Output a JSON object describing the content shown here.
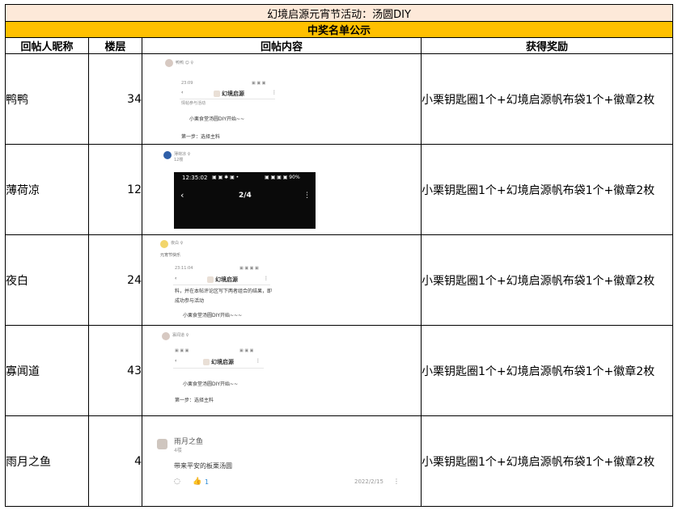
{
  "title": "幻境启源元宵节活动：汤圆DIY",
  "subtitle": "中奖名单公示",
  "headers": [
    "回帖人昵称",
    "楼层",
    "回帖内容",
    "获得奖励"
  ],
  "rows": [
    {
      "nickname": "鸭鸭",
      "floor": "34",
      "reward": "小栗钥匙圈1个+幻境启源帆布袋1个+徽章2枚",
      "shot": {
        "user": "鸭鸭 ☺ ♀",
        "time": "23:09",
        "brand": "幻境启源",
        "line1": "情帖参与活动",
        "line2": "小栗食堂汤圆DIY开始~~",
        "line3": "第一步：选择主料"
      }
    },
    {
      "nickname": "薄荷凉",
      "floor": "12",
      "reward": "小栗钥匙圈1个+幻境启源帆布袋1个+徽章2枚",
      "shot": {
        "user": "薄荷凉 ♀",
        "floor_tag": "12楼",
        "time": "12:35:02",
        "icons": "▣ ▣ ✱ ▣ •",
        "status": "▣ ▣ ▣ ▣ 90%",
        "page": "2/4",
        "back": "‹",
        "more": "⋮"
      }
    },
    {
      "nickname": "夜白",
      "floor": "24",
      "reward": "小栗钥匙圈1个+幻境启源帆布袋1个+徽章2枚",
      "shot": {
        "user": "夜白 ♀",
        "caption": "元宵节快乐",
        "time": "23:11:04",
        "brand": "幻境启源",
        "line1": "料，并在本帖评论区写下两者组合的结果，即",
        "line2": "成功参与活动",
        "line3": "小栗食堂汤圆DIY开始~~~"
      }
    },
    {
      "nickname": "寡闻道",
      "floor": "43",
      "reward": "小栗钥匙圈1个+幻境启源帆布袋1个+徽章2枚",
      "shot": {
        "user": "寡闻道 ♀",
        "brand": "幻境启源",
        "line1": "小栗食堂汤圆DIY开始~~",
        "line2": "第一步：选择主料"
      }
    },
    {
      "nickname": "雨月之鱼",
      "floor": "4",
      "reward": "小栗钥匙圈1个+幻境启源帆布袋1个+徽章2枚",
      "shot": {
        "user": "雨月之鱼",
        "floor_tag": "4楼",
        "text": "带来平安的板栗汤圆",
        "likes": "1",
        "date": "2022/2/15",
        "more": "⋮"
      }
    }
  ]
}
